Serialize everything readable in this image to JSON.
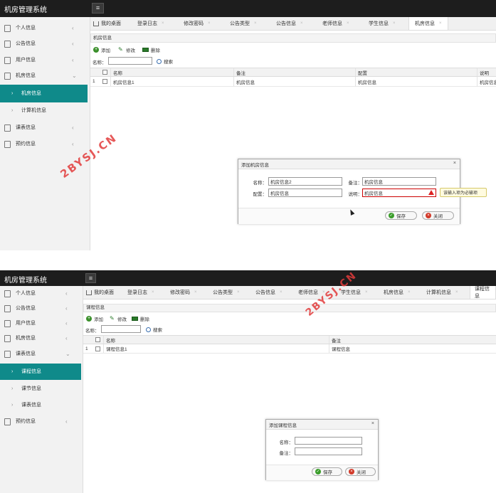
{
  "watermark": "2BYSJ.CN",
  "screen1": {
    "app_title": "机房管理系统",
    "sidebar": [
      {
        "label": "个人信息",
        "icon": "user-icon"
      },
      {
        "label": "公告信息",
        "icon": "document-icon"
      },
      {
        "label": "用户信息",
        "icon": "document-icon"
      },
      {
        "label": "机房信息",
        "icon": "document-icon"
      },
      {
        "label": "机房信息",
        "icon": "arrow-right-icon"
      },
      {
        "label": "计算机信息",
        "icon": "arrow-right-icon"
      },
      {
        "label": "课表信息",
        "icon": "document-icon"
      },
      {
        "label": "预约信息",
        "icon": "document-icon"
      }
    ],
    "tabs": [
      "我的桌面",
      "登录日志",
      "修改密码",
      "公告类型",
      "公告信息",
      "老师信息",
      "学生信息",
      "机房信息"
    ],
    "panel_title": "机房信息",
    "toolbar": {
      "add": "添加",
      "edit": "修改",
      "delete": "删除"
    },
    "search": {
      "label": "名称：",
      "button": "搜索"
    },
    "columns": [
      "名称",
      "备注",
      "配置",
      "说明"
    ],
    "rows": [
      {
        "num": "1",
        "cells": [
          "机房信息1",
          "机房信息",
          "机房信息",
          "机房信息"
        ]
      }
    ],
    "dialog": {
      "title": "添加机房信息",
      "close": "×",
      "fields": {
        "name_label": "名称：",
        "name_value": "机房信息2",
        "remark_label": "备注：",
        "remark_value": "机房信息",
        "config_label": "配置：",
        "config_value": "机房信息",
        "desc_label": "说明：",
        "desc_value": "机房信息"
      },
      "tooltip": "该输入项为必输项",
      "save": "保存",
      "close_btn": "关闭"
    }
  },
  "screen2": {
    "app_title": "机房管理系统",
    "sidebar": [
      {
        "label": "个人信息",
        "icon": "user-icon"
      },
      {
        "label": "公告信息",
        "icon": "document-icon"
      },
      {
        "label": "用户信息",
        "icon": "document-icon"
      },
      {
        "label": "机房信息",
        "icon": "document-icon"
      },
      {
        "label": "课表信息",
        "icon": "document-icon"
      },
      {
        "label": "课程信息",
        "icon": "arrow-right-icon"
      },
      {
        "label": "课节信息",
        "icon": "arrow-right-icon"
      },
      {
        "label": "课表信息",
        "icon": "arrow-right-icon"
      },
      {
        "label": "预约信息",
        "icon": "document-icon"
      }
    ],
    "tabs": [
      "我的桌面",
      "登录日志",
      "修改密码",
      "公告类型",
      "公告信息",
      "老师信息",
      "学生信息",
      "机房信息",
      "计算机信息",
      "课程信息"
    ],
    "panel_title": "课程信息",
    "toolbar": {
      "add": "添加",
      "edit": "修改",
      "delete": "删除"
    },
    "search": {
      "label": "名称：",
      "button": "搜索"
    },
    "columns": [
      "名称",
      "备注"
    ],
    "rows": [
      {
        "num": "1",
        "cells": [
          "课程信息1",
          "课程信息"
        ]
      }
    ],
    "dialog": {
      "title": "添加课程信息",
      "close": "×",
      "fields": {
        "name_label": "名称：",
        "name_value": "",
        "remark_label": "备注：",
        "remark_value": ""
      },
      "save": "保存",
      "close_btn": "关闭"
    }
  }
}
